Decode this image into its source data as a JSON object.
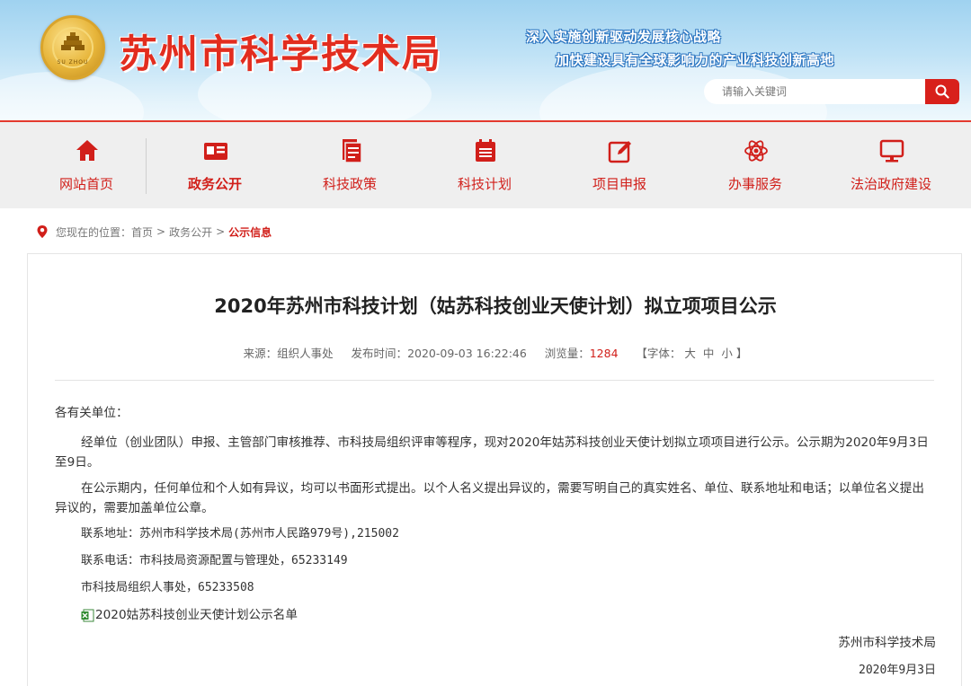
{
  "header": {
    "site_title": "苏州市科学技术局",
    "seal_text": "SU ZHOU",
    "slogan_line1": "深入实施创新驱动发展核心战略",
    "slogan_line2": "加快建设具有全球影响力的产业科技创新高地",
    "search": {
      "placeholder": "请输入关键词",
      "icon": "search-icon"
    },
    "brand_color": "#e22d1f"
  },
  "nav": {
    "items": [
      {
        "label": "网站首页",
        "icon": "home-icon"
      },
      {
        "label": "政务公开",
        "icon": "id-card-icon",
        "active": true
      },
      {
        "label": "科技政策",
        "icon": "document-icon"
      },
      {
        "label": "科技计划",
        "icon": "calendar-icon"
      },
      {
        "label": "项目申报",
        "icon": "edit-icon"
      },
      {
        "label": "办事服务",
        "icon": "atom-icon"
      },
      {
        "label": "法治政府建设",
        "icon": "monitor-icon"
      }
    ]
  },
  "breadcrumb": {
    "prefix": "您现在的位置：",
    "items": [
      "首页",
      "政务公开"
    ],
    "current": "公示信息",
    "separator": ">"
  },
  "article": {
    "title": "2020年苏州市科技计划（姑苏科技创业天使计划）拟立项项目公示",
    "meta": {
      "source_label": "来源：",
      "source": "组织人事处",
      "time_label": "发布时间：",
      "time": "2020-09-03 16:22:46",
      "views_label": "浏览量：",
      "views": "1284",
      "font_label": "【字体：",
      "font_large": "大",
      "font_medium": "中",
      "font_small": "小",
      "font_close": "】"
    },
    "greeting": "各有关单位：",
    "para1": "经单位（创业团队）申报、主管部门审核推荐、市科技局组织评审等程序，现对2020年姑苏科技创业天使计划拟立项项目进行公示。公示期为2020年9月3日至9日。",
    "para2": "在公示期内，任何单位和个人如有异议，均可以书面形式提出。以个人名义提出异议的，需要写明自己的真实姓名、单位、联系地址和电话；以单位名义提出异议的，需要加盖单位公章。",
    "address": "联系地址：苏州市科学技术局(苏州市人民路979号),215002",
    "phone": "联系电话：市科技局资源配置与管理处，65233149",
    "phone2": "市科技局组织人事处，65233508",
    "attachment": "2020姑苏科技创业天使计划公示名单",
    "signature_org": "苏州市科学技术局",
    "signature_date": "2020年9月3日"
  }
}
